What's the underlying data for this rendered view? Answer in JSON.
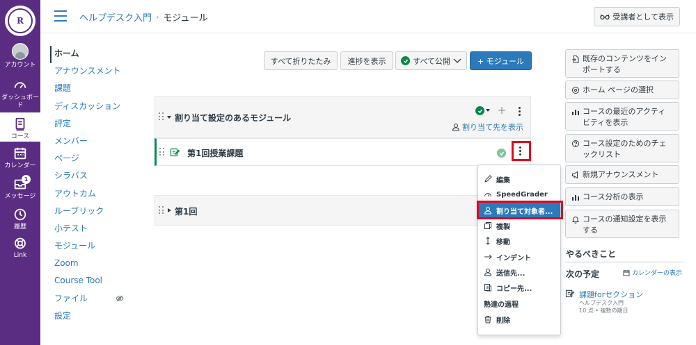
{
  "global_nav": {
    "logo_text": "R",
    "logo_ring_text": "RIKKYO UNIVERSITY",
    "items": [
      {
        "label": "アカウント",
        "icon": "avatar"
      },
      {
        "label": "ダッシュボード",
        "icon": "dashboard-icon"
      },
      {
        "label": "コース",
        "icon": "courses-icon"
      },
      {
        "label": "カレンダー",
        "icon": "calendar-icon"
      },
      {
        "label": "メッセージ",
        "icon": "inbox-icon",
        "badge": "1"
      },
      {
        "label": "履歴",
        "icon": "history-icon"
      },
      {
        "label": "Link",
        "icon": "help-icon"
      }
    ]
  },
  "header": {
    "breadcrumb_course": "ヘルプデスク入門",
    "breadcrumb_sep": "›",
    "breadcrumb_page": "モジュール",
    "student_view_label": "受講者として表示"
  },
  "course_nav": {
    "items": [
      "ホーム",
      "アナウンスメント",
      "課題",
      "ディスカッション",
      "評定",
      "メンバー",
      "ページ",
      "シラバス",
      "アウトカム",
      "ルーブリック",
      "小テスト",
      "モジュール",
      "Zoom",
      "Course Tool",
      "ファイル",
      "設定"
    ]
  },
  "toolbar": {
    "collapse_all": "すべて折りたたみ",
    "view_progress": "進捗を表示",
    "publish_all": "すべて公開",
    "add_module": "+ モジュール"
  },
  "modules": [
    {
      "title": "割り当て設定のあるモジュール",
      "assign_link": "割り当て先を表示"
    },
    {
      "title": "第1回"
    }
  ],
  "module_item": {
    "title": "第1回授業課題"
  },
  "menu": {
    "items": [
      "編集",
      "SpeedGrader",
      "割り当て対象者...",
      "複製",
      "移動",
      "インデント",
      "送信先...",
      "コピー先...",
      "熟達の過程",
      "削除"
    ]
  },
  "sidebar": {
    "buttons": [
      "既存のコンテンツをインポートする",
      "ホーム ページの選択",
      "コースの最近のアクティビティを表示",
      "コース設定のためのチェックリスト",
      "新規アナウンスメント",
      "コース分析の表示",
      "コースの通知設定を表示する"
    ],
    "todo_heading": "やるべきこと",
    "upcoming_heading": "次の予定",
    "calendar_link": "カレンダーの表示",
    "upcoming_item": {
      "title": "課題forセクション",
      "course": "ヘルプデスク入門",
      "meta": "10 点 • 複数の期日"
    }
  },
  "colors": {
    "nav": "#5a2d82",
    "link": "#2b7abc",
    "success": "#0b874b",
    "highlight": "#e0061f"
  }
}
